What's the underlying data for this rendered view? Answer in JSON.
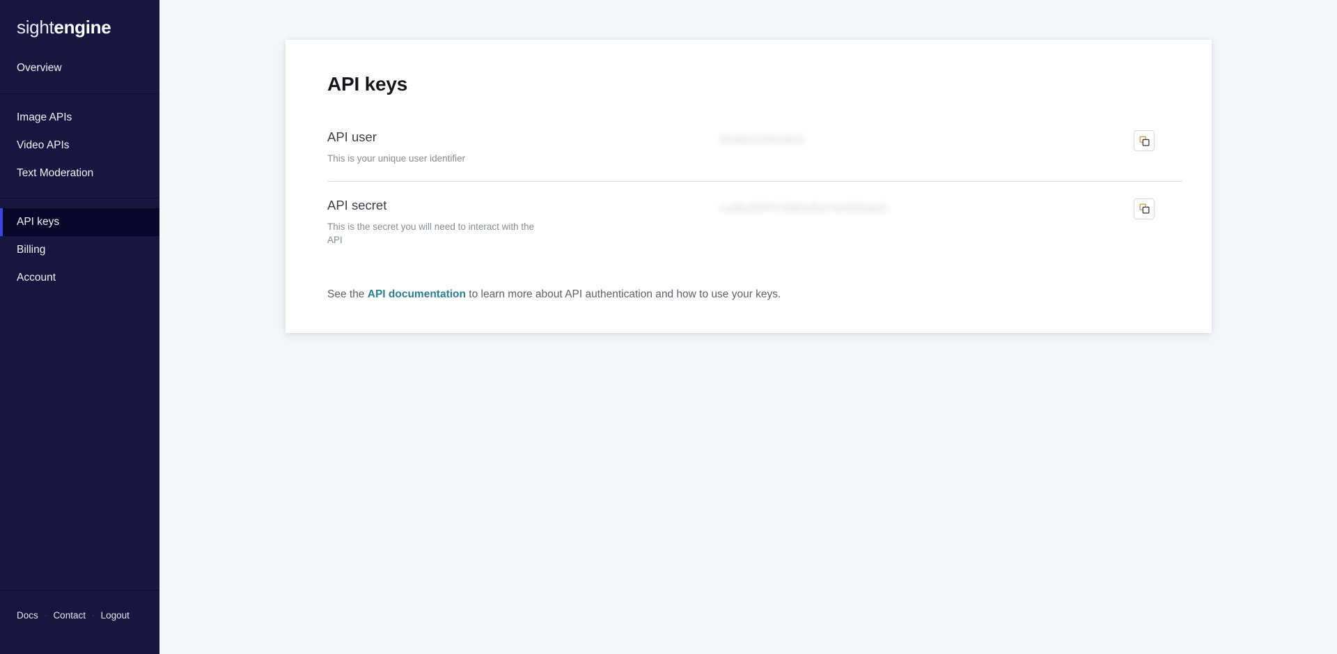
{
  "brand": {
    "logo_light": "sight",
    "logo_bold": "engine"
  },
  "sidebar": {
    "group1": [
      {
        "label": "Overview",
        "active": false
      }
    ],
    "group2": [
      {
        "label": "Image APIs",
        "active": false
      },
      {
        "label": "Video APIs",
        "active": false
      },
      {
        "label": "Text Moderation",
        "active": false
      }
    ],
    "group3": [
      {
        "label": "API keys",
        "active": true
      },
      {
        "label": "Billing",
        "active": false
      },
      {
        "label": "Account",
        "active": false
      }
    ],
    "footer": {
      "docs": "Docs",
      "contact": "Contact",
      "logout": "Logout",
      "separator": "·"
    },
    "active_indicator_color": "#3d46d8",
    "background_color": "#161640",
    "active_background_color": "#08082a"
  },
  "main": {
    "page_title": "API keys",
    "rows": [
      {
        "label": "API user",
        "description": "This is your unique user identifier",
        "value": "8183221813422",
        "copy_icon": "copy-icon",
        "copy_tooltip": "Copy"
      },
      {
        "label": "API secret",
        "description": "This is the secret you will need to interact with the API",
        "value": "Lw9uZSfYCSdHcEw7wX8SwaO",
        "copy_icon": "copy-icon",
        "copy_tooltip": "Copy"
      }
    ],
    "doc_note": {
      "prefix": "See the ",
      "link_text": "API documentation",
      "suffix": " to learn more about API authentication and how to use your keys.",
      "link_color": "#2c7f93"
    }
  },
  "theme": {
    "page_background": "#f3f6fa",
    "card_background": "#ffffff",
    "divider_color": "#e1e3e8"
  }
}
